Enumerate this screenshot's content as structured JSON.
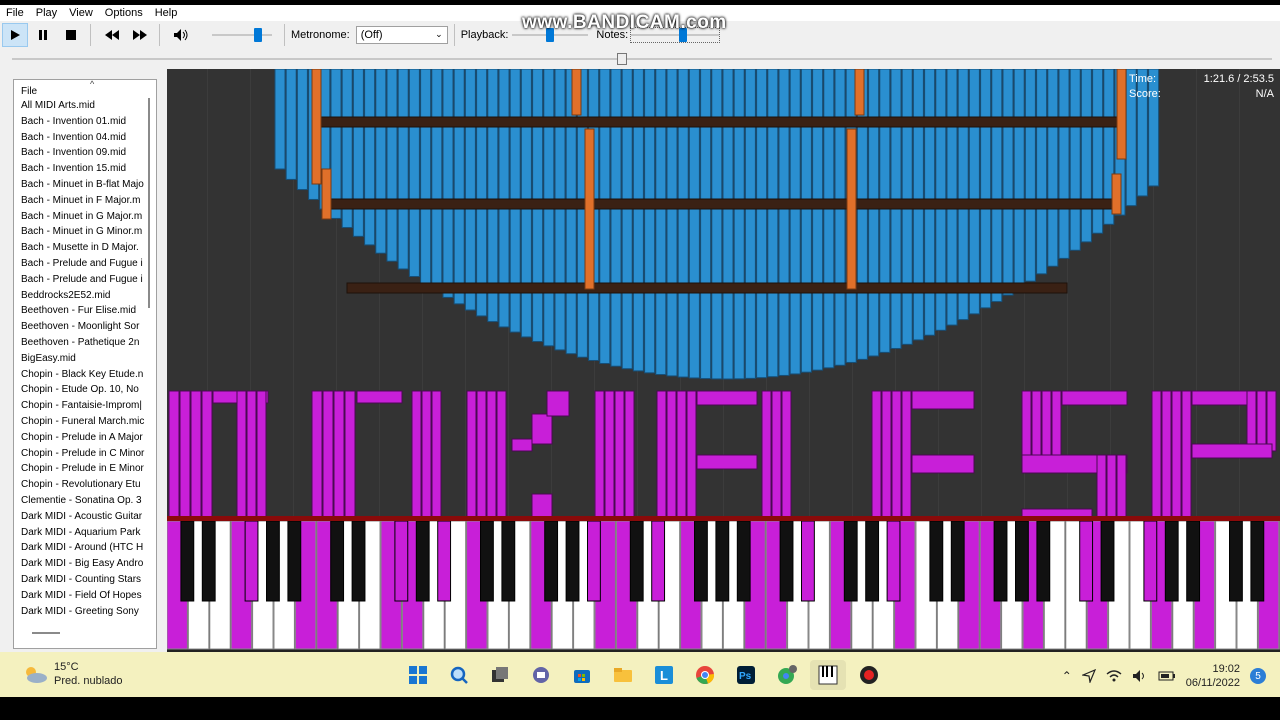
{
  "menu": [
    "File",
    "Play",
    "View",
    "Options",
    "Help"
  ],
  "toolbar": {
    "metronome_label": "Metronome:",
    "metronome_value": "(Off)",
    "playback_label": "Playback:",
    "notes_label": "Notes:",
    "volume_level": 0.8,
    "playback_level": 0.5,
    "notes_level": 0.6
  },
  "watermark": "www.BANDICAM.com",
  "seek": {
    "position": 0.48
  },
  "filelist": {
    "header": "File",
    "items": [
      "All MIDI Arts.mid",
      "Bach - Invention 01.mid",
      "Bach - Invention 04.mid",
      "Bach - Invention 09.mid",
      "Bach - Invention 15.mid",
      "Bach - Minuet in B-flat Majo",
      "Bach - Minuet in F Major.m",
      "Bach - Minuet in G Major.m",
      "Bach - Minuet in G Minor.m",
      "Bach - Musette in D Major.",
      "Bach - Prelude and Fugue i",
      "Bach - Prelude and Fugue i",
      "Beddrocks2E52.mid",
      "Beethoven - Fur Elise.mid",
      "Beethoven - Moonlight Sor",
      "Beethoven - Pathetique 2n",
      "BigEasy.mid",
      "Chopin - Black Key Etude.n",
      "Chopin - Etude Op. 10, No",
      "Chopin - Fantaisie-Improm|",
      "Chopin - Funeral March.mic",
      "Chopin - Prelude in A Major",
      "Chopin - Prelude in C Minor",
      "Chopin - Prelude in E Minor",
      "Chopin - Revolutionary Etu",
      "Clementie - Sonatina Op. 3",
      "Dark MIDI - Acoustic Guitar",
      "Dark MIDI - Aquarium Park",
      "Dark MIDI - Around (HTC H",
      "Dark MIDI - Big Easy Andro",
      "Dark MIDI - Counting Stars",
      "Dark MIDI - Field Of Hopes",
      "Dark MIDI - Greeting Sony"
    ]
  },
  "info": {
    "time_label": "Time:",
    "time_value": "1:21.6 / 2:53.5",
    "score_label": "Score:",
    "score_value": "N/A"
  },
  "taskbar": {
    "temperature": "15°C",
    "weather": "Pred. nublado",
    "time": "19:02",
    "date": "06/11/2022",
    "notifications": "5"
  },
  "icons": {
    "taskbar": [
      "windows-start-icon",
      "search-icon",
      "task-view-icon",
      "chat-icon",
      "store-icon",
      "file-explorer-icon",
      "app-l-icon",
      "chrome-icon",
      "photoshop-icon",
      "chrome-profile-icon",
      "piano-app-icon",
      "record-icon"
    ],
    "tray": [
      "chevron-up-icon",
      "location-icon",
      "wifi-icon",
      "volume-icon",
      "battery-icon"
    ]
  },
  "colors": {
    "blue_notes": "#2a8fd0",
    "orange_notes": "#e0702a",
    "purple_notes": "#c81fd8",
    "visual_bg": "#333333",
    "taskbar_bg": "#f4f1bf"
  }
}
